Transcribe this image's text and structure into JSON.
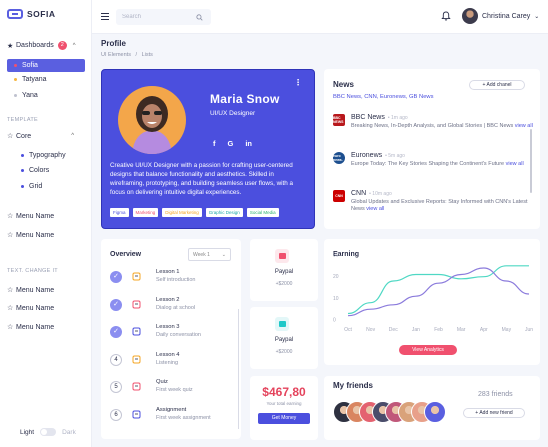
{
  "app": {
    "name": "SOFIA"
  },
  "sidebar": {
    "dashboards": {
      "label": "Dashboards",
      "badge": "2"
    },
    "dashboard_items": [
      {
        "label": "Sofia",
        "active": true,
        "color": "#f0506e"
      },
      {
        "label": "Tatyana",
        "active": false,
        "color": "#f5b63f"
      },
      {
        "label": "Yana",
        "active": false,
        "color": "#bfc2cf"
      }
    ],
    "template_label": "TEMPLATE",
    "core": {
      "label": "Core"
    },
    "core_items": [
      {
        "label": "Typography",
        "color": "#4b4fde"
      },
      {
        "label": "Colors",
        "color": "#4b4fde"
      },
      {
        "label": "Grid",
        "color": "#4b4fde"
      }
    ],
    "menu_items_a": [
      "Menu Name",
      "Menu Name"
    ],
    "text_change_label": "TEXT. CHANGE IT",
    "menu_items_b": [
      "Menu Name",
      "Menu Name",
      "Menu Name"
    ],
    "theme": {
      "light": "Light",
      "dark": "Dark"
    }
  },
  "topbar": {
    "search_placeholder": "Search",
    "user_name": "Christina Carey"
  },
  "page": {
    "title": "Profile",
    "breadcrumb": [
      "UI Elements",
      "/",
      "Lists"
    ]
  },
  "profile": {
    "name": "Maria Snow",
    "role": "UI/UX Designer",
    "social": [
      "f",
      "G",
      "in"
    ],
    "bio": "Creative UI/UX Designer with a passion for crafting user-centered designs that balance functionality and aesthetics. Skilled in wireframing, prototyping, and building seamless user flows, with a focus on delivering intuitive digital experiences.",
    "tags": [
      {
        "label": "Figma",
        "color": "#4b4fde"
      },
      {
        "label": "Marketing",
        "color": "#f0506e"
      },
      {
        "label": "Digital Marketing",
        "color": "#f5a623"
      },
      {
        "label": "Graphic Design",
        "color": "#1ba8a8"
      },
      {
        "label": "Social Media",
        "color": "#2db36f"
      }
    ]
  },
  "news": {
    "title": "News",
    "add_button": "+ Add chanel",
    "channels_line": "BBC News, CNN, Euronews, GB News",
    "view_all": "view all",
    "items": [
      {
        "source": "BBC News",
        "logo": "BBC NEWS",
        "logo_color": "#b8181c",
        "time": "• 1m ago",
        "text": "Breaking News, In-Depth Analysis, and Global Stories | BBC News"
      },
      {
        "source": "Euronews",
        "logo": "euro news.",
        "logo_color": "#1d4f8f",
        "time": "• 5m ago",
        "text": "Europe Today: The Key Stories Shaping the Continent's Future"
      },
      {
        "source": "CNN",
        "logo": "CNN",
        "logo_color": "#cc0000",
        "time": "• 10m ago",
        "text": "Global Updates and Exclusive Reports: Stay Informed with CNN's Latest News"
      }
    ]
  },
  "overview": {
    "title": "Overview",
    "week_select": "Week 1",
    "lessons": [
      {
        "marker": "✓",
        "done": true,
        "name": "Lesson 1",
        "sub": "Self introduction"
      },
      {
        "marker": "✓",
        "done": true,
        "name": "Lesson 2",
        "sub": "Dialog at school"
      },
      {
        "marker": "✓",
        "done": true,
        "name": "Lesson 3",
        "sub": "Daily conversation"
      },
      {
        "marker": "4",
        "done": false,
        "name": "Lesson 4",
        "sub": "Listening"
      },
      {
        "marker": "5",
        "done": false,
        "name": "Quiz",
        "sub": "First week quiz"
      },
      {
        "marker": "6",
        "done": false,
        "name": "Assignment",
        "sub": "First week assignment"
      }
    ]
  },
  "payments": [
    {
      "name": "Paypal",
      "amount": "+$2000",
      "color": "#f0506e",
      "bg": "#fde8ec"
    },
    {
      "name": "Paypal",
      "amount": "+$2000",
      "color": "#1ec8c8",
      "bg": "#e3f7f8"
    }
  ],
  "balance": {
    "amount": "$467,80",
    "label": "Your total earning",
    "button": "Get Money"
  },
  "earning": {
    "title": "Earning",
    "button": "View Analytics"
  },
  "chart_data": {
    "type": "line",
    "categories": [
      "Oct",
      "Nov",
      "Dec",
      "Jan",
      "Feb",
      "Mar",
      "Apr",
      "May",
      "Jun"
    ],
    "yticks": [
      0,
      10,
      20,
      30
    ],
    "ylim": [
      0,
      30
    ],
    "series": [
      {
        "color": "#4fd8c4",
        "values": [
          3,
          8,
          18,
          21,
          21,
          19,
          20,
          25,
          25
        ]
      },
      {
        "color": "#8b7bdc",
        "values": [
          2,
          5,
          7,
          11,
          17,
          21,
          24,
          18,
          12
        ]
      }
    ]
  },
  "friends": {
    "title": "My friends",
    "count": "283 friends",
    "add_button": "+ Add new friend",
    "avatars": [
      "#2e3140",
      "#d98560",
      "#e46270",
      "#4b4d6b",
      "#c0587a",
      "#d9a27a",
      "#e8a08a",
      "#5a5fe0"
    ]
  }
}
